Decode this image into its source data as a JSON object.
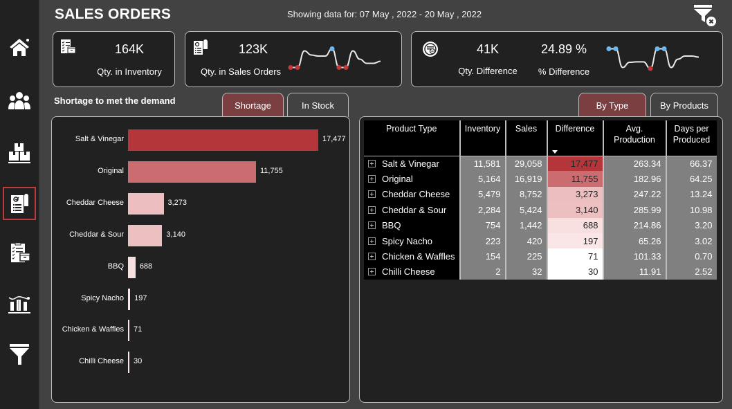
{
  "header": {
    "title": "SALES ORDERS",
    "date_range": "Showing data for: 07 May , 2022 - 20 May , 2022",
    "clear_filter_icon": "funnel-clear-icon"
  },
  "sidebar": {
    "items": [
      {
        "name": "home",
        "icon": "home-icon",
        "active": false
      },
      {
        "name": "customers",
        "icon": "people-icon",
        "active": false
      },
      {
        "name": "inventory",
        "icon": "boxes-icon",
        "active": false
      },
      {
        "name": "sales-orders",
        "icon": "order-receipt-icon",
        "active": true
      },
      {
        "name": "inventory-checklist",
        "icon": "checklist-box-icon",
        "active": false
      },
      {
        "name": "analytics",
        "icon": "bar-trend-icon",
        "active": false
      },
      {
        "name": "filters",
        "icon": "funnel-icon",
        "active": false
      }
    ]
  },
  "kpis": {
    "inventory": {
      "value": "164K",
      "label": "Qty. in Inventory",
      "icon": "inventory-checklist-icon"
    },
    "sales_orders": {
      "value": "123K",
      "label": "Qty. in Sales Orders",
      "icon": "order-receipt-icon",
      "sparkline": [
        0.05,
        0.05,
        0.85,
        0.65,
        0.6,
        0.6,
        0.95,
        0.05,
        0.05,
        0.85,
        0.45,
        0.25,
        0.25,
        0.35
      ],
      "markers": {
        "low": [
          0,
          1,
          7,
          8
        ],
        "high": [
          6
        ]
      }
    },
    "difference": {
      "value": "41K",
      "label": "Qty. Difference",
      "pct_value": "24.89 %",
      "pct_label": "% Difference",
      "icon": "difference-icon",
      "sparkline": [
        0.95,
        0.95,
        0.05,
        0.3,
        0.32,
        0.32,
        0.0,
        0.95,
        0.95,
        0.05,
        0.45,
        0.6,
        0.6,
        0.55
      ],
      "markers": {
        "low": [
          6
        ],
        "high": [
          0,
          1,
          7,
          8
        ]
      }
    }
  },
  "colors": {
    "low_marker": "#c0393b",
    "high_marker": "#6cb8f0",
    "accent": "#c0393b",
    "active_tab": "#7b3f41"
  },
  "shortage": {
    "title": "Shortage to met the demand",
    "tabs": [
      {
        "label": "Shortage",
        "active": true
      },
      {
        "label": "In Stock",
        "active": false
      }
    ]
  },
  "table_view": {
    "tabs": [
      {
        "label": "By Type",
        "active": true
      },
      {
        "label": "By Products",
        "active": false
      }
    ]
  },
  "chart_data": {
    "type": "bar",
    "orientation": "horizontal",
    "title": "Shortage to met the demand",
    "categories": [
      "Salt & Vinegar",
      "Original",
      "Cheddar Cheese",
      "Cheddar & Sour",
      "BBQ",
      "Spicy Nacho",
      "Chicken & Waffles",
      "Chilli Cheese"
    ],
    "values": [
      17477,
      11755,
      3273,
      3140,
      688,
      197,
      71,
      30
    ],
    "value_labels": [
      "17,477",
      "11,755",
      "3,273",
      "3,140",
      "688",
      "197",
      "71",
      "30"
    ],
    "xlabel": "",
    "ylabel": "",
    "xlim": [
      0,
      17477
    ],
    "grid": false,
    "color_scale": {
      "low": "#fbe9ea",
      "mid": "#ecbfc0",
      "high": "#b5363a"
    }
  },
  "matrix": {
    "columns": [
      "Product Type",
      "Inventory",
      "Sales",
      "Difference",
      "Avg. Production",
      "Days per Produced"
    ],
    "sorted_column": "Difference",
    "rows": [
      {
        "type": "Salt & Vinegar",
        "inventory": "11,581",
        "sales": "29,058",
        "difference": "17,477",
        "diff_value": 17477,
        "avg": "263.34",
        "days": "66.37"
      },
      {
        "type": "Original",
        "inventory": "5,164",
        "sales": "16,919",
        "difference": "11,755",
        "diff_value": 11755,
        "avg": "182.96",
        "days": "64.25"
      },
      {
        "type": "Cheddar Cheese",
        "inventory": "5,479",
        "sales": "8,752",
        "difference": "3,273",
        "diff_value": 3273,
        "avg": "247.22",
        "days": "13.24"
      },
      {
        "type": "Cheddar & Sour",
        "inventory": "2,284",
        "sales": "5,424",
        "difference": "3,140",
        "diff_value": 3140,
        "avg": "285.99",
        "days": "10.98"
      },
      {
        "type": "BBQ",
        "inventory": "754",
        "sales": "1,442",
        "difference": "688",
        "diff_value": 688,
        "avg": "214.86",
        "days": "3.20"
      },
      {
        "type": "Spicy Nacho",
        "inventory": "223",
        "sales": "420",
        "difference": "197",
        "diff_value": 197,
        "avg": "65.26",
        "days": "3.02"
      },
      {
        "type": "Chicken & Waffles",
        "inventory": "154",
        "sales": "225",
        "difference": "71",
        "diff_value": 71,
        "avg": "101.33",
        "days": "0.70"
      },
      {
        "type": "Chilli Cheese",
        "inventory": "2",
        "sales": "32",
        "difference": "30",
        "diff_value": 30,
        "avg": "11.91",
        "days": "2.52"
      }
    ]
  }
}
